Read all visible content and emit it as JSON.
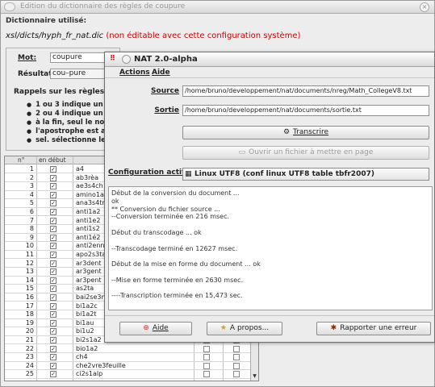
{
  "back_window": {
    "title": "Edition du dictionnaire des règles de coupure",
    "dict_used_label": "Dictionnaire utilisé:",
    "dict_path": "xsl/dicts/hyph_fr_nat.dic",
    "dict_warning": "(non éditable avec cette configuration système)",
    "mot_label": "Mot:",
    "mot_value": "coupure",
    "resultat_label": "Résultat:",
    "resultat_value": "cou–pure",
    "rules_title": "Rappels sur les règles (co",
    "rules": [
      "1 ou 3 indique un",
      "2 ou 4 indique un",
      "à la fin, seul le no",
      "l'apostrophe est a",
      "sel. sélectionne le"
    ],
    "table": {
      "headers": [
        "n°",
        "en début"
      ],
      "rows": [
        {
          "n": "1",
          "word": "a4"
        },
        {
          "n": "2",
          "word": "ab3rèa"
        },
        {
          "n": "3",
          "word": "ae3s4ch"
        },
        {
          "n": "4",
          "word": "amino1a2"
        },
        {
          "n": "5",
          "word": "ana3s4tr"
        },
        {
          "n": "6",
          "word": "anti1a2"
        },
        {
          "n": "7",
          "word": "anti1e2"
        },
        {
          "n": "8",
          "word": "anti1s2"
        },
        {
          "n": "9",
          "word": "anti1é2"
        },
        {
          "n": "10",
          "word": "anti2enne"
        },
        {
          "n": "11",
          "word": "apo2s3ta"
        },
        {
          "n": "12",
          "word": "ar3dent"
        },
        {
          "n": "13",
          "word": "ar3gent"
        },
        {
          "n": "14",
          "word": "ar3pent"
        },
        {
          "n": "15",
          "word": "as2ta"
        },
        {
          "n": "16",
          "word": "bai2se3m"
        },
        {
          "n": "17",
          "word": "bi1a2c"
        },
        {
          "n": "18",
          "word": "bi1a2t"
        },
        {
          "n": "19",
          "word": "bi1au"
        },
        {
          "n": "20",
          "word": "bi1u2"
        },
        {
          "n": "21",
          "word": "bi2s1a2"
        },
        {
          "n": "22",
          "word": "bio1a2"
        },
        {
          "n": "23",
          "word": "ch4"
        },
        {
          "n": "24",
          "word": "che2vre3feuille"
        },
        {
          "n": "25",
          "word": "ci2s1alp"
        }
      ]
    }
  },
  "front_window": {
    "title": "NAT 2.0-alpha",
    "menus": [
      "Actions",
      "Aide"
    ],
    "source_label": "Source",
    "source_value": "/home/bruno/developpement/nat/documents/nreg/Math_CollegeV8.txt",
    "sortie_label": "Sortie",
    "sortie_value": "/home/bruno/developpement/nat/documents/sortie.txt",
    "transcrire_label": "Transcrire",
    "open_output_label": "Ouvrir un fichier à mettre en page",
    "config_label": "Configuration active:",
    "config_value": "Linux UTF8 (conf linux UTF8 table tbfr2007)",
    "log_lines": [
      "Début de la conversion du document ...",
      "ok",
      "** Conversion du fichier source ...",
      "--Conversion terminée en 216 msec.",
      "",
      "Début du transcodage ... ok",
      "",
      "--Transcodage terminé en 12627 msec.",
      "",
      "Début de la mise en forme du document ... ok",
      "",
      "--Mise en forme terminée en 2630 msec.",
      "",
      "----Transcription terminée en 15,473 sec."
    ],
    "aide_label": "Aide",
    "apropos_label": "A propos...",
    "rapporter_label": "Rapporter une erreur"
  },
  "icons": [
    "close-icon",
    "window-icon",
    "nat-logo-icon",
    "transcrire-icon",
    "open-file-icon",
    "config-icon",
    "help-icon",
    "star-icon",
    "bug-icon",
    "checkbox-icon",
    "scroll-down-icon"
  ],
  "colors": {
    "warning": "#cc0000",
    "window_bg": "#ececec"
  }
}
